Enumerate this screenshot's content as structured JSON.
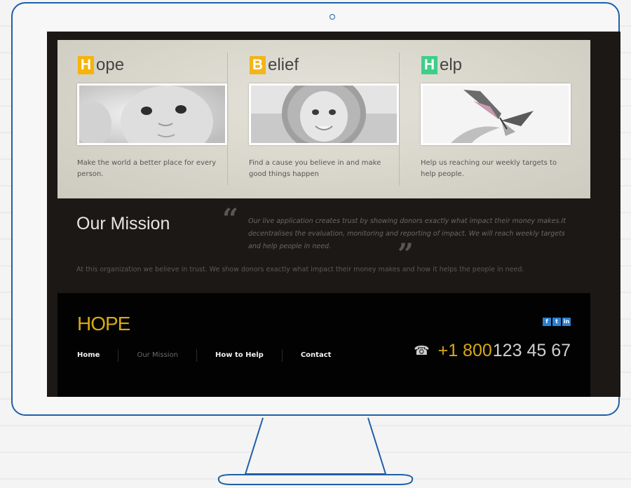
{
  "columns": [
    {
      "letter": "H",
      "rest": "ope",
      "color": "#f6b30a",
      "text": "Make the world a better place for every person."
    },
    {
      "letter": "B",
      "rest": "elief",
      "color": "#f2b51a",
      "text": "Find a cause you believe in and make good things happen"
    },
    {
      "letter": "H",
      "rest": "elp",
      "color": "#3fce88",
      "text": "Help us reaching our weekly targets to help people."
    }
  ],
  "mission": {
    "title": "Our Mission",
    "quote": "Our live application creates trust by showing donors exactly what impact their money makes.It decentralises the evaluation, monitoring and reporting of impact. We will reach weekly targets and help people in need.",
    "line": "At this organization we believe in trust. We show donors exactly what impact their money makes and how it helps the people in need."
  },
  "footer": {
    "brand": "HOPE",
    "nav": [
      "Home",
      "Our Mission",
      "How to Help",
      "Contact"
    ],
    "social": [
      "f",
      "t",
      "in"
    ],
    "phone_highlight": "+1 800",
    "phone_rest": "123 45 67"
  },
  "colors": {
    "accent_yellow": "#d8a912",
    "monitor_blue": "#1f5fa8"
  }
}
